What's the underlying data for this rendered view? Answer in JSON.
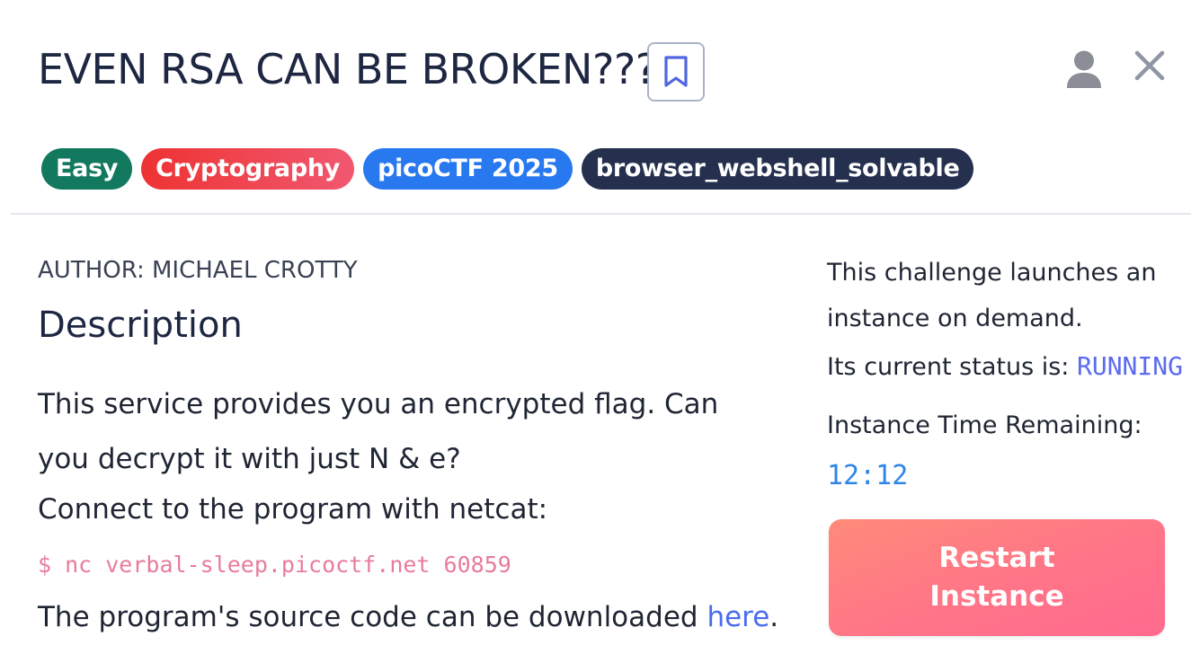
{
  "challenge": {
    "title": "EVEN RSA CAN BE BROKEN???"
  },
  "tags": [
    {
      "label": "Easy",
      "color": "#12795f"
    },
    {
      "label": "Cryptography",
      "color": "#f0414e"
    },
    {
      "label": "picoCTF 2025",
      "color": "#2878f0"
    },
    {
      "label": "browser_webshell_solvable",
      "color": "#25304f"
    }
  ],
  "main": {
    "author": "AUTHOR: MICHAEL CROTTY",
    "description_heading": "Description",
    "description_text": "This service provides you an encrypted flag. Can you decrypt it with just N & e?",
    "connect_text": "Connect to the program with netcat:",
    "command": "$ nc verbal-sleep.picoctf.net 60859",
    "source_text_before": "The program's source code can be downloaded ",
    "source_link": "here",
    "source_text_after": "."
  },
  "sidebar": {
    "launch_text": "This challenge launches an instance on demand.",
    "status_label": "Its current status is: ",
    "status_value": "RUNNING",
    "time_label": "Instance Time Remaining:",
    "time_value": "12:12",
    "restart_button": "Restart Instance"
  },
  "icons": {
    "bookmark": "bookmark-icon",
    "user": "user-icon",
    "close": "close-icon"
  },
  "colors": {
    "status": "#5b6bf0",
    "timer": "#2f86e8",
    "command": "#e87c9a",
    "link": "#4a6cf0",
    "restart_button": "#ff7588"
  }
}
